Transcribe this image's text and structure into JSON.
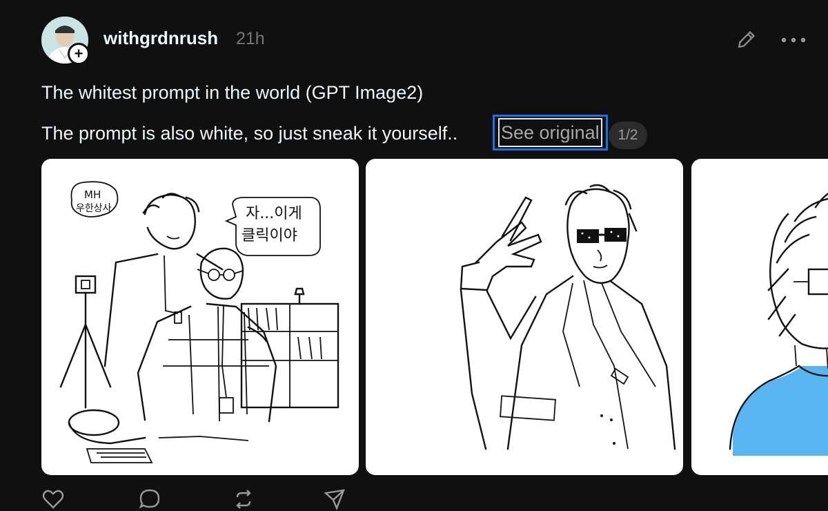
{
  "post": {
    "username": "withgrdnrush",
    "timestamp": "21h",
    "text_line_1": "The whitest prompt in the world (GPT Image2)",
    "text_line_2": "The prompt is also white, so just sneak it yourself..",
    "see_original_label": "See original",
    "page_indicator": "1/2"
  },
  "header_actions": {
    "edit_icon": "pencil-icon",
    "more_icon": "more-horizontal-icon"
  },
  "images": [
    {
      "kind": "sketch",
      "speech_bubble_small": "MH\n우한상사",
      "speech_bubble_large_line1": "자...이게",
      "speech_bubble_large_line2": "클릭이야"
    },
    {
      "kind": "sketch"
    },
    {
      "kind": "sketch",
      "accent_color": "#5ab4f0"
    }
  ],
  "action_bar": {
    "icons": [
      "heart-icon",
      "comment-icon",
      "repost-icon",
      "share-icon"
    ]
  },
  "colors": {
    "background": "#101010",
    "text_primary": "#f3f5f7",
    "text_secondary": "#777777",
    "focus_ring": "#1f6fe0",
    "pill_background": "#2b2b2b"
  }
}
